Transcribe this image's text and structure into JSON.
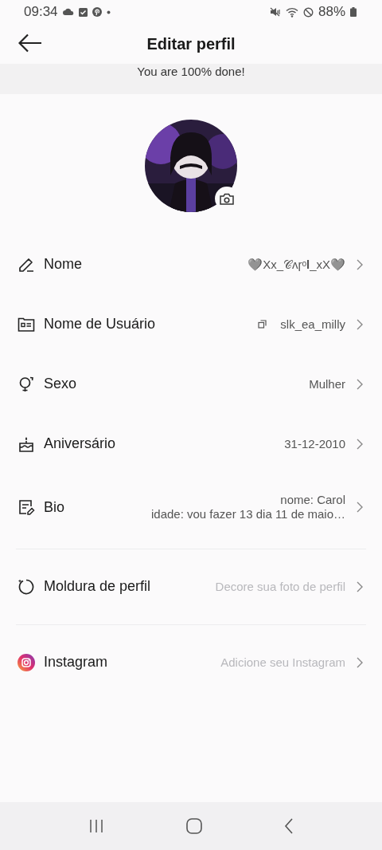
{
  "status_bar": {
    "time": "09:34",
    "battery": "88%"
  },
  "header": {
    "title": "Editar perfil"
  },
  "progress_banner": {
    "text": "You are 100% done!"
  },
  "sections": [
    [
      {
        "label": "Nome",
        "value": "🩶Xx_𝒞ᴧɼᵒ𝐥_xX🩶",
        "copyable": false
      },
      {
        "label": "Nome de Usuário",
        "value": "slk_ea_milly",
        "copyable": true
      },
      {
        "label": "Sexo",
        "value": "Mulher",
        "copyable": false
      },
      {
        "label": "Aniversário",
        "value": "31-12-2010",
        "copyable": false
      },
      {
        "label": "Bio",
        "value": "nome: Carol\nidade: vou fazer 13 dia 11 de maio…",
        "copyable": false
      }
    ],
    [
      {
        "label": "Moldura de perfil",
        "placeholder": "Decore sua foto de perfil",
        "copyable": false
      }
    ],
    [
      {
        "label": "Instagram",
        "placeholder": "Adicione seu Instagram",
        "copyable": false
      }
    ]
  ]
}
